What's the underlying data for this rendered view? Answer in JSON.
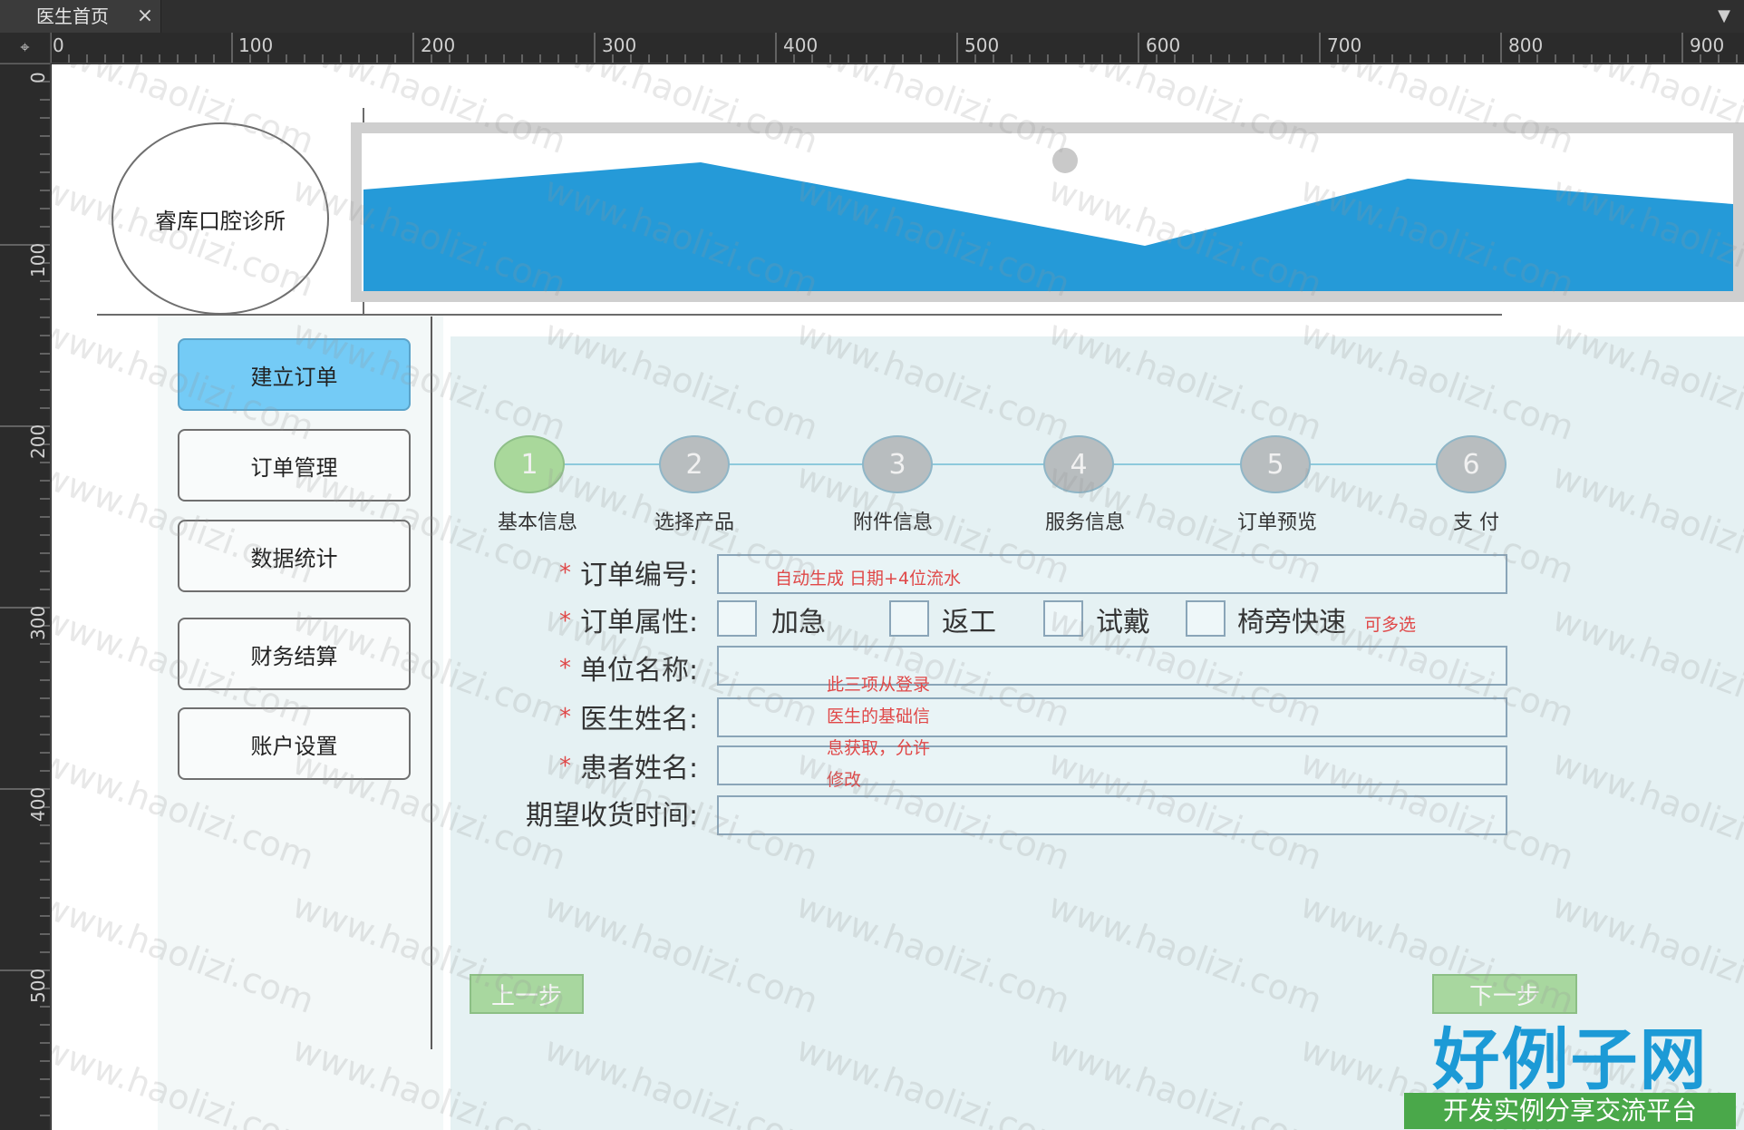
{
  "tab": {
    "title": "医生首页",
    "close": "×",
    "menu": "▼"
  },
  "ruler": {
    "corner": "⌖",
    "top": [
      "0",
      "100",
      "200",
      "300",
      "400",
      "500",
      "600",
      "700",
      "800",
      "900"
    ],
    "left": [
      "0",
      "100",
      "200",
      "300",
      "400",
      "500"
    ]
  },
  "header": {
    "clinic_name": "睿库口腔诊所"
  },
  "sidebar": {
    "items": [
      {
        "label": "建立订单"
      },
      {
        "label": "订单管理"
      },
      {
        "label": "数据统计"
      },
      {
        "label": "财务结算"
      },
      {
        "label": "账户设置"
      }
    ]
  },
  "steps": [
    {
      "num": "1",
      "label": "基本信息"
    },
    {
      "num": "2",
      "label": "选择产品"
    },
    {
      "num": "3",
      "label": "附件信息"
    },
    {
      "num": "4",
      "label": "服务信息"
    },
    {
      "num": "5",
      "label": "订单预览"
    },
    {
      "num": "6",
      "label": "支 付"
    }
  ],
  "form": {
    "required_mark": "*",
    "order_no": {
      "label": "订单编号:",
      "note": "自动生成 日期+4位流水"
    },
    "order_attr": {
      "label": "订单属性:",
      "options": [
        "加急",
        "返工",
        "试戴",
        "椅旁快速"
      ],
      "note": "可多选"
    },
    "unit_name": {
      "label": "单位名称:"
    },
    "doctor_name": {
      "label": "医生姓名:"
    },
    "patient_name": {
      "label": "患者姓名:"
    },
    "expected_time": {
      "label": "期望收货时间:"
    },
    "autofill_note": [
      "此三项从登录",
      "医生的基础信",
      "息获取，允许",
      "修改"
    ]
  },
  "buttons": {
    "prev": "上一步",
    "next": "下一步"
  },
  "watermark": "www.haolizi.com",
  "site_logo": {
    "title": "好例子网",
    "subtitle": "开发实例分享交流平台"
  }
}
